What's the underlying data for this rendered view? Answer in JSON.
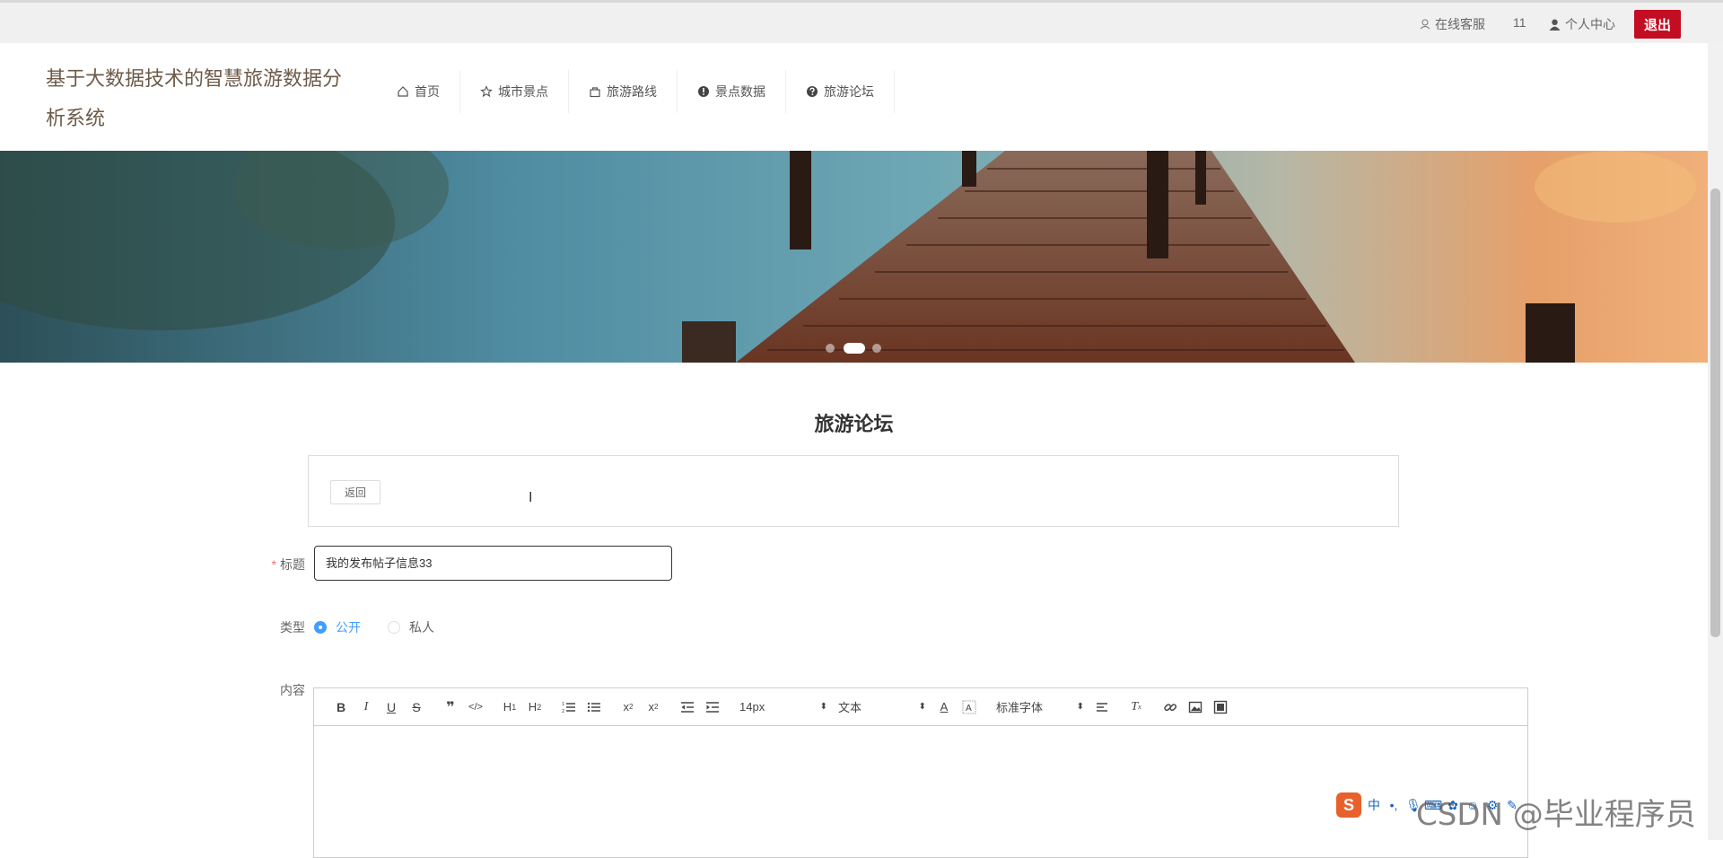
{
  "topbar": {
    "customer_service": "在线客服",
    "count": "11",
    "user_center": "个人中心",
    "logout": "退出"
  },
  "header": {
    "site_title": "基于大数据技术的智慧旅游数据分析系统",
    "nav": [
      {
        "label": "首页",
        "icon": "home-icon"
      },
      {
        "label": "城市景点",
        "icon": "star-icon"
      },
      {
        "label": "旅游路线",
        "icon": "bag-icon"
      },
      {
        "label": "景点数据",
        "icon": "info-icon"
      },
      {
        "label": "旅游论坛",
        "icon": "question-icon"
      }
    ]
  },
  "banner": {
    "slides": 3,
    "active_slide": 2
  },
  "main": {
    "title": "旅游论坛",
    "back_label": "返回",
    "form": {
      "title_label": "标题",
      "title_required": "*",
      "title_value": "我的发布帖子信息33",
      "type_label": "类型",
      "type_options": [
        "公开",
        "私人"
      ],
      "type_selected": "公开",
      "content_label": "内容"
    },
    "editor": {
      "size_value": "14px",
      "header_value": "文本",
      "font_value": "标准字体"
    }
  },
  "overlay": {
    "ime_logo": "S",
    "ime_mode": "中",
    "watermark": "CSDN @毕业程序员"
  },
  "colors": {
    "logout_bg": "#c30d23",
    "accent": "#409eff",
    "title_color": "#6d5a48"
  }
}
